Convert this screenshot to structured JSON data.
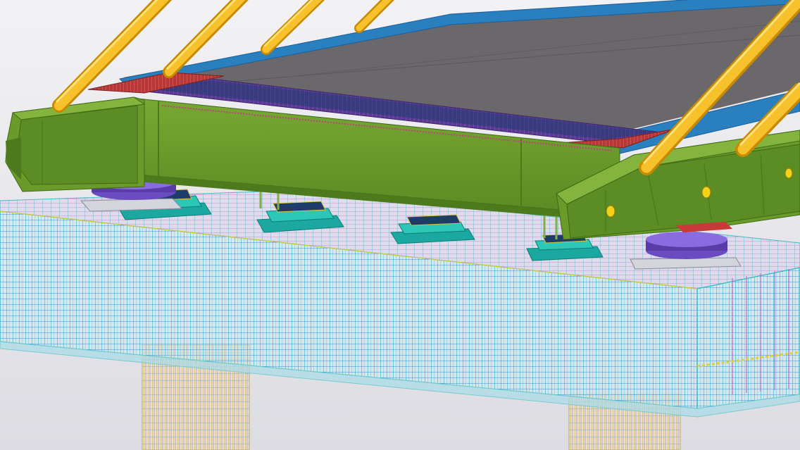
{
  "viewport": {
    "view": "3D model view",
    "background_top": "#f2f2f4",
    "background_bottom": "#dcdce2"
  },
  "scene": {
    "objects": [
      "cable-stays",
      "bridge-deck-slab",
      "deck-edge-beam",
      "steel-cross-girder",
      "box-edge-girder-left",
      "box-edge-girder-right",
      "spherical-bearing-left",
      "spherical-bearing-right",
      "temporary-jacks",
      "pier-cap-rebar-cage",
      "pier-columns"
    ]
  },
  "colors": {
    "steel_girder": "#6a9a2a",
    "steel_girder_dark": "#4d7a1c",
    "steel_girder_light": "#85b43e",
    "deck_top": "#6b686c",
    "deck_edge_blue": "#2a7fbf",
    "deck_edge_blue_dark": "#1b5e99",
    "shear_studs_purple": "#6a3fa0",
    "cable_yellow": "#f2b21a",
    "cable_yellow_dark": "#c88a00",
    "rebar_cyan": "#38c4c8",
    "rebar_blue": "#3a7ed8",
    "rebar_magenta": "#c056c8",
    "rebar_yellow": "#d8c43c",
    "concrete_ghost": "#bfe3ee",
    "bearing_purple": "#6a4cc0",
    "jack_teal": "#1aa8a0",
    "red_plate": "#c83a3a"
  }
}
